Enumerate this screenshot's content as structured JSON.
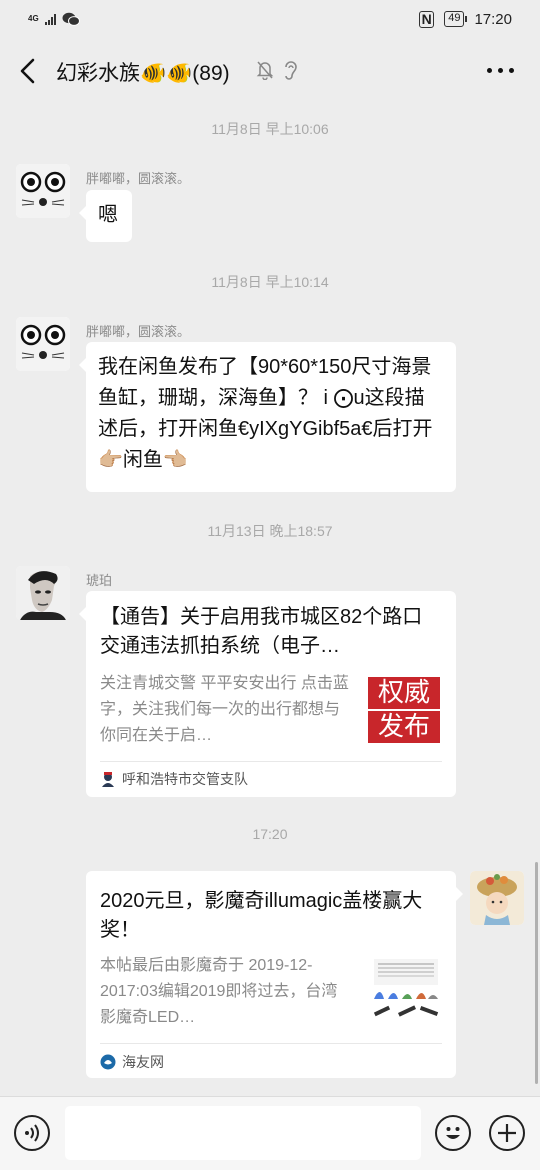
{
  "status": {
    "network": "4G",
    "battery": "49",
    "time": "17:20"
  },
  "header": {
    "title": "幻彩水族🐠🐠(89)"
  },
  "messages": [
    {
      "timestamp": "11月8日 早上10:06",
      "sender": "胖嘟嘟，圆滚滚。",
      "text": "嗯"
    },
    {
      "timestamp": "11月8日 早上10:14",
      "sender": "胖嘟嘟，圆滚滚。",
      "text": "我在闲鱼发布了【90*60*150尺寸海景鱼缸，珊瑚，深海鱼】？ i ⨀u这段描述后，打开闲鱼€yIXgYGibf5a€后打开👉🏼闲鱼👈🏼"
    },
    {
      "timestamp": "11月13日 晚上18:57",
      "sender": "琥珀",
      "card": {
        "title": "【通告】关于启用我市城区82个路口交通违法抓拍系统（电子…",
        "desc": "关注青城交警 平平安安出行 点击蓝字，关注我们每一次的出行都想与你同在关于启…",
        "thumb_line1": "权威",
        "thumb_line2": "发布",
        "source": "呼和浩特市交管支队"
      }
    },
    {
      "timestamp": "17:20",
      "card": {
        "title": "2020元旦，影魔奇illumagic盖楼赢大奖！",
        "desc": "本帖最后由影魔奇于 2019-12-2017:03编辑2019即将过去，台湾影魔奇LED…",
        "source": "海友网"
      }
    }
  ],
  "icons": {
    "back": "chevron-left-icon",
    "mute": "bell-off-icon",
    "ear": "ear-icon",
    "more": "more-icon",
    "voice": "voice-icon",
    "emoji": "emoji-icon",
    "plus": "plus-icon"
  },
  "colors": {
    "background": "#ededed",
    "bubble": "#ffffff",
    "thumb_red": "#c8262b"
  }
}
